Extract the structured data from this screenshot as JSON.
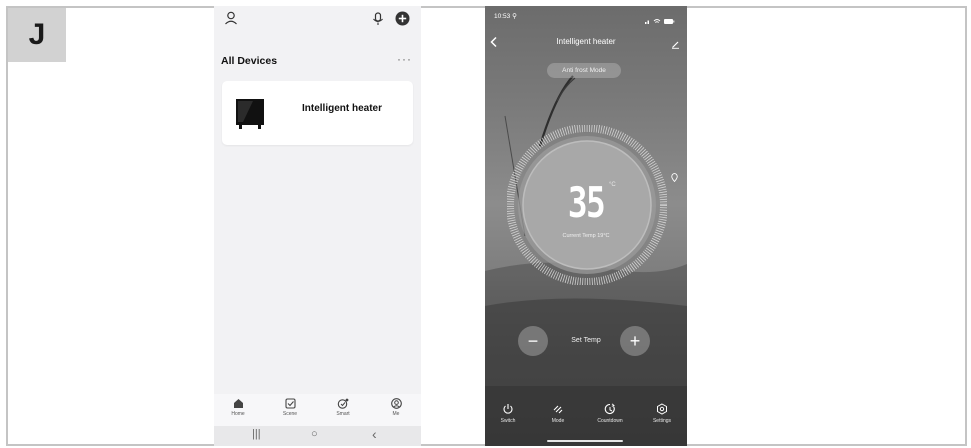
{
  "figure": {
    "label": "J"
  },
  "phone_list": {
    "title": "All Devices",
    "more_label": "···",
    "icons": {
      "profile": "user-icon",
      "voice": "microphone-icon",
      "add": "plus-circle-icon"
    },
    "devices": [
      {
        "name": "Intelligent heater",
        "icon": "heater-icon"
      }
    ],
    "tabs": [
      {
        "label": "Home",
        "icon": "home-icon"
      },
      {
        "label": "Scene",
        "icon": "check-square-icon"
      },
      {
        "label": "Smart",
        "icon": "smart-icon"
      },
      {
        "label": "Me",
        "icon": "user-circle-icon"
      }
    ],
    "nav": {
      "recents": "|||",
      "home": "○",
      "back": "‹"
    }
  },
  "phone_heater": {
    "status_time": "10:53 ⚲",
    "title": "Intelligent heater",
    "mode": "Anti frost Mode",
    "set_temperature": "35",
    "unit": "°C",
    "current_temp": "Current Temp 19°C",
    "set_temp_label": "Set Temp",
    "minus_label": "−",
    "plus_label": "+",
    "bottom_tabs": [
      {
        "label": "Switch",
        "icon": "power-icon"
      },
      {
        "label": "Mode",
        "icon": "mode-icon"
      },
      {
        "label": "Countdown",
        "icon": "timer-icon"
      },
      {
        "label": "Settings",
        "icon": "settings-icon"
      }
    ]
  }
}
